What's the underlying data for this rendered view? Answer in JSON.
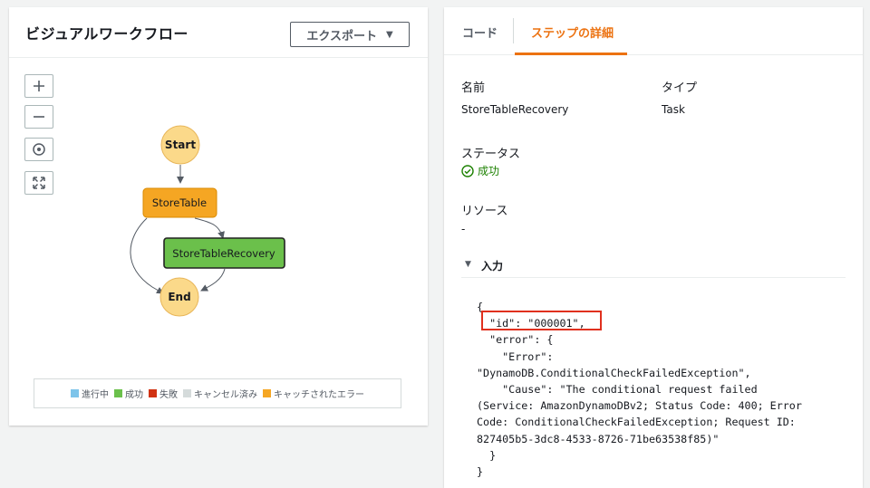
{
  "left_panel": {
    "title": "ビジュアルワークフロー",
    "export_button": "エクスポート",
    "graph": {
      "start": "Start",
      "store_table": "StoreTable",
      "store_table_recovery": "StoreTableRecovery",
      "end": "End"
    },
    "legend": [
      {
        "label": "進行中",
        "color": "#7dc4ea"
      },
      {
        "label": "成功",
        "color": "#6bc04b"
      },
      {
        "label": "失敗",
        "color": "#d13212"
      },
      {
        "label": "キャンセル済み",
        "color": "#d5dbdb"
      },
      {
        "label": "キャッチされたエラー",
        "color": "#f5a623"
      }
    ]
  },
  "right_panel": {
    "tabs": {
      "code": "コード",
      "step_details": "ステップの詳細"
    },
    "name_label": "名前",
    "name_value": "StoreTableRecovery",
    "type_label": "タイプ",
    "type_value": "Task",
    "status_label": "ステータス",
    "status_value": "成功",
    "resource_label": "リソース",
    "resource_value": "-",
    "input_label": "入力",
    "input_json": "{\n  \"id\": \"000001\",\n  \"error\": {\n    \"Error\":\n\"DynamoDB.ConditionalCheckFailedException\",\n    \"Cause\": \"The conditional request failed\n(Service: AmazonDynamoDBv2; Status Code: 400; Error\nCode: ConditionalCheckFailedException; Request ID:\n827405b5-3dc8-4533-8726-71be63538f85)\"\n  }\n}"
  },
  "colors": {
    "accent": "#ec7211",
    "success": "#1d8102",
    "node_start_end": "#fbd98a",
    "node_caught_error": "#f5a623",
    "node_success": "#6bc04b",
    "highlight": "#e0301e"
  }
}
